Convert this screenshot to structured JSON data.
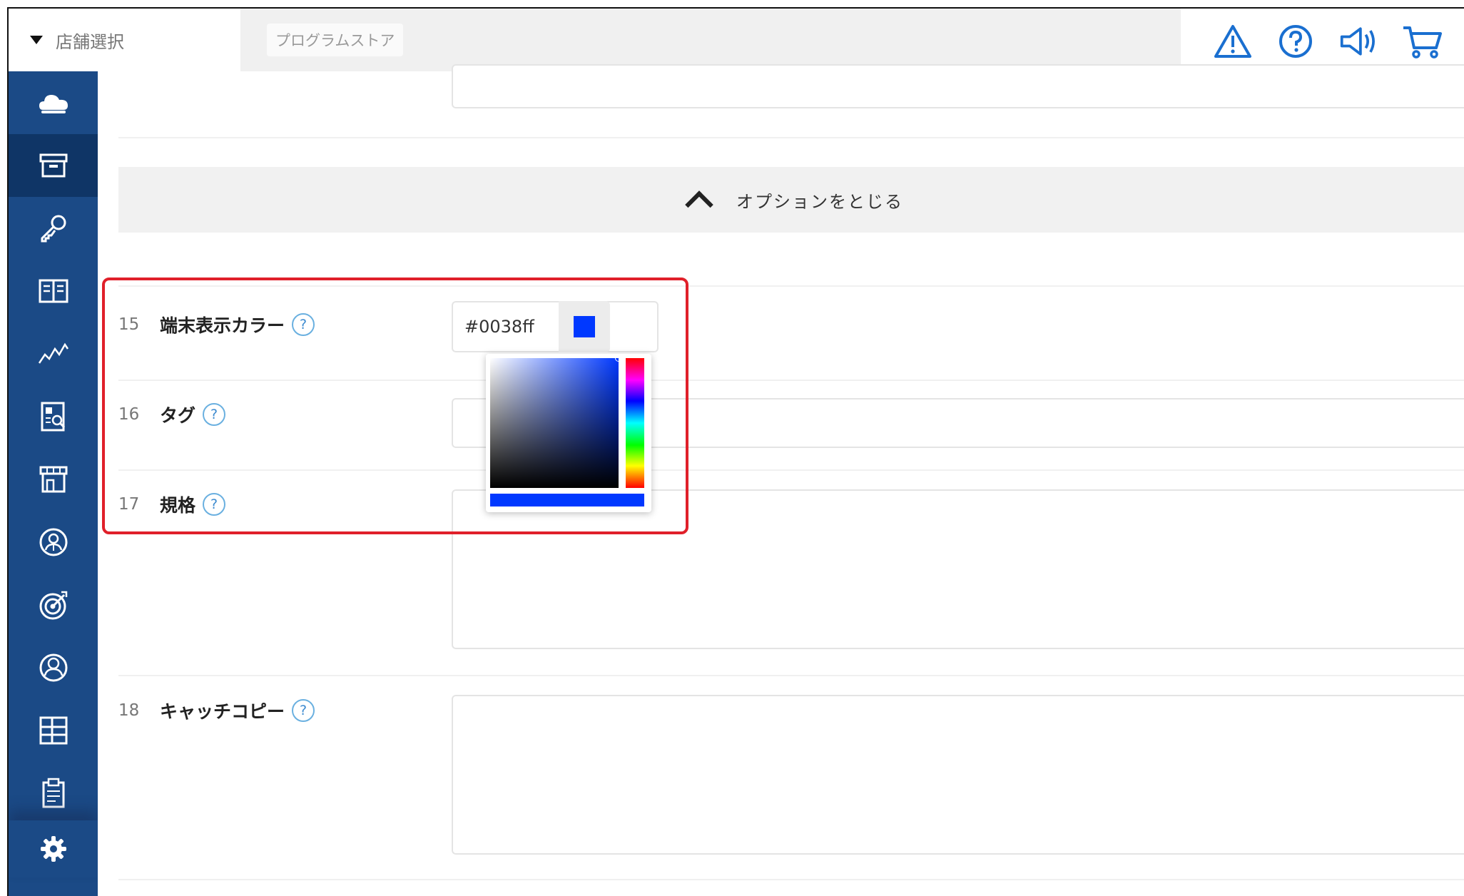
{
  "header": {
    "store_select_label": "店舗選択",
    "program_store_label": "プログラムストア",
    "icons": [
      "warning-icon",
      "help-icon",
      "announcement-icon",
      "cart-icon"
    ]
  },
  "sidebar": {
    "items": [
      "cloud-icon",
      "archive-icon",
      "key-icon",
      "book-icon",
      "analytics-icon",
      "report-icon",
      "store-icon",
      "user-badge-icon",
      "target-icon",
      "account-icon",
      "grid-icon",
      "clipboard-icon"
    ],
    "active_index": 1,
    "settings_icon": "gear-icon"
  },
  "content": {
    "toggle_options_label": "オプションをとじる",
    "fields": [
      {
        "number": "15",
        "label": "端末表示カラー",
        "value": "#0038ff"
      },
      {
        "number": "16",
        "label": "タグ"
      },
      {
        "number": "17",
        "label": "規格"
      },
      {
        "number": "18",
        "label": "キャッチコピー"
      }
    ],
    "help_symbol": "?"
  },
  "colors": {
    "sidebar": "#1b4a86",
    "sidebar_active": "#0f3566",
    "selected_color": "#0038ff",
    "highlight": "#e0202a",
    "icon_blue": "#1a6fd0"
  }
}
